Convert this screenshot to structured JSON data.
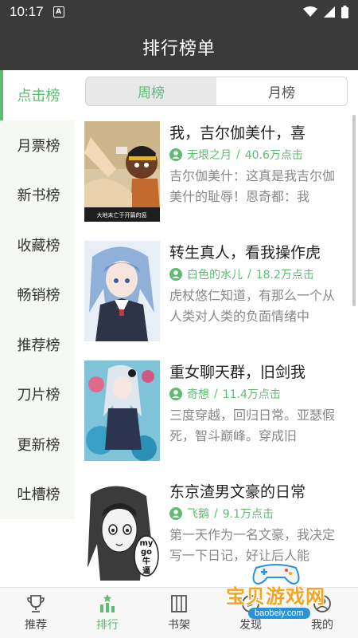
{
  "status_bar": {
    "time": "10:17",
    "notification_icon": "a-square-icon",
    "icons": [
      "wifi-icon",
      "signal-icon",
      "battery-icon"
    ]
  },
  "header": {
    "title": "排行榜单"
  },
  "sidebar": {
    "items": [
      {
        "label": "点击榜",
        "active": true
      },
      {
        "label": "月票榜"
      },
      {
        "label": "新书榜"
      },
      {
        "label": "收藏榜"
      },
      {
        "label": "畅销榜"
      },
      {
        "label": "推荐榜"
      },
      {
        "label": "刀片榜"
      },
      {
        "label": "更新榜"
      },
      {
        "label": "吐槽榜"
      }
    ]
  },
  "tabs": [
    {
      "label": "周榜",
      "active": true
    },
    {
      "label": "月榜"
    }
  ],
  "books": [
    {
      "title": "我，吉尔伽美什，喜",
      "author": "无垠之月",
      "clicks": "40.6万点击",
      "desc": "吉尔伽美什：这真是我吉尔伽美什的耻辱！恩奇都：我",
      "cover_caption": "大地未亡于开篇的惩"
    },
    {
      "title": "转生真人，看我操作虎",
      "author": "白色的水儿",
      "clicks": "18.2万点击",
      "desc": "虎杖悠仁知道，有那么一个从人类对人类的负面情绪中"
    },
    {
      "title": "重女聊天群，旧剑我",
      "author": "奇想",
      "clicks": "11.4万点击",
      "desc": "三度穿越，回归日常。亚瑟假死，智斗巅峰。穿成旧"
    },
    {
      "title": "东京渣男文豪的日常",
      "author": "飞鹅",
      "clicks": "9.1万点击",
      "desc": "第一天作为一名文豪，我决定写一下日记，好让后人能",
      "cover_speech": [
        "my",
        "go",
        "牛",
        "逼"
      ]
    }
  ],
  "separator": "/",
  "bottom_nav": [
    {
      "label": "推荐",
      "icon": "trophy-icon"
    },
    {
      "label": "排行",
      "icon": "ranking-icon",
      "active": true
    },
    {
      "label": "书架",
      "icon": "bookshelf-icon"
    },
    {
      "label": "发现",
      "icon": "discover-icon"
    },
    {
      "label": "我的",
      "icon": "profile-icon"
    }
  ],
  "watermark": {
    "text": "宝贝游戏网",
    "url": "baobeiy.com"
  },
  "colors": {
    "accent": "#5cbd72",
    "header": "#3a3a3a",
    "sidebar_bg": "#f6f9f3"
  }
}
